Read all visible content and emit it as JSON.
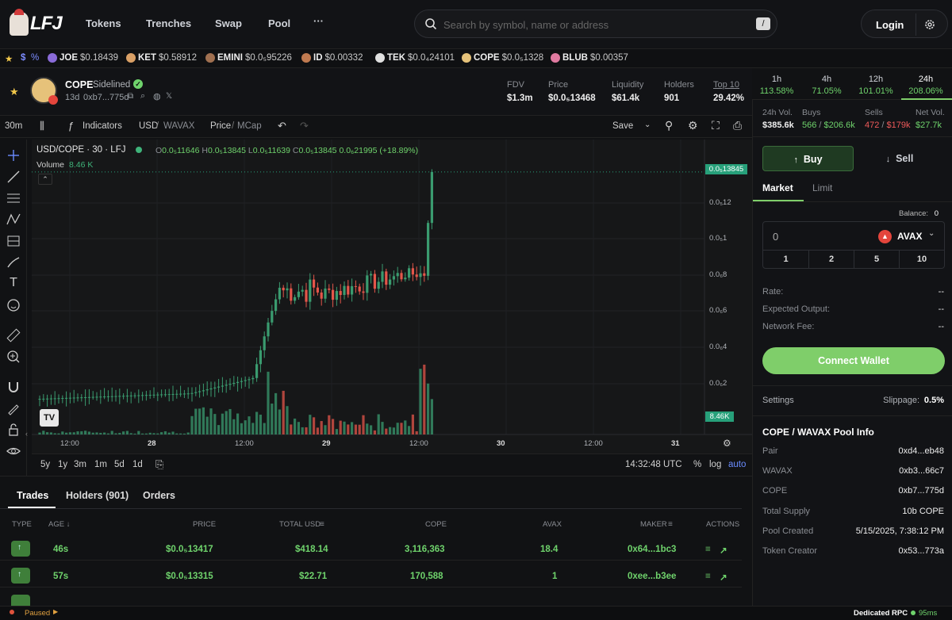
{
  "nav": {
    "logo": "LFJ",
    "tokens": "Tokens",
    "trenches": "Trenches",
    "swap": "Swap",
    "pool": "Pool",
    "more": "···"
  },
  "search": {
    "placeholder": "Search by symbol, name or address",
    "shortcut": "/"
  },
  "auth": {
    "login": "Login"
  },
  "ticker": {
    "percent": "%",
    "items": [
      {
        "sym": "JOE",
        "price": "$0.18439"
      },
      {
        "sym": "KET",
        "price": "$0.58912"
      },
      {
        "sym": "EMINI",
        "price": "$0.0₅95226"
      },
      {
        "sym": "ID",
        "price": "$0.00332"
      },
      {
        "sym": "TEK",
        "price": "$0.0₄24101"
      },
      {
        "sym": "COPE",
        "price": "$0.0₅1328"
      },
      {
        "sym": "BLUB",
        "price": "$0.00357"
      }
    ]
  },
  "token": {
    "name": "COPE",
    "status": "Sidelined",
    "age": "13d",
    "address": "0xb7...775d",
    "stats": [
      {
        "label": "FDV",
        "value": "$1.3m"
      },
      {
        "label": "Price",
        "value": "$0.0₅13468"
      },
      {
        "label": "Liquidity",
        "value": "$61.4k"
      },
      {
        "label": "Holders",
        "value": "901"
      },
      {
        "label": "Top 10",
        "value": "29.42%"
      }
    ]
  },
  "timeframes": [
    {
      "label": "1h",
      "change": "113.58%"
    },
    {
      "label": "4h",
      "change": "71.05%"
    },
    {
      "label": "12h",
      "change": "101.01%"
    },
    {
      "label": "24h",
      "change": "208.06%"
    }
  ],
  "volume": {
    "vol_label": "24h Vol.",
    "vol_value": "$385.6k",
    "buys_label": "Buys",
    "buys_count": "566",
    "buys_value": "$206.6k",
    "sells_label": "Sells",
    "sells_count": "472",
    "sells_value": "$179k",
    "net_label": "Net Vol.",
    "net_value": "$27.7k"
  },
  "charttb": {
    "interval": "30m",
    "indicators": "Indicators",
    "usd": "USD",
    "wavax": "WAVAX",
    "price": "Price",
    "mcap": "MCap",
    "save": "Save"
  },
  "chart": {
    "pair": "USD/COPE · 30 · LFJ",
    "o_label": "O",
    "o": "0.0₅11646",
    "h_label": "H",
    "h": "0.0₅13845",
    "l_label": "L",
    "l": "0.0₅11639",
    "c_label": "C",
    "c": "0.0₅13845",
    "change": "0.0₆21995 (+18.89%)",
    "volume_label": "Volume",
    "volume_value": "8.46 K",
    "last_price": "0.0₅13845",
    "last_volume": "8.46K",
    "y_ticks": [
      "0.0₅12",
      "0.0₅1",
      "0.0₆8",
      "0.0₆6",
      "0.0₆4",
      "0.0₆2"
    ],
    "x_ticks": [
      "12:00",
      "28",
      "12:00",
      "29",
      "12:00",
      "30",
      "12:00",
      "31"
    ]
  },
  "rangebar": {
    "ranges": [
      "5y",
      "1y",
      "3m",
      "1m",
      "5d",
      "1d"
    ],
    "time": "14:32:48 UTC",
    "pct": "%",
    "log": "log",
    "auto": "auto"
  },
  "trades": {
    "tabs": [
      "Trades",
      "Holders (901)",
      "Orders"
    ],
    "headers": {
      "type": "TYPE",
      "age": "AGE ↓",
      "price": "PRICE",
      "total": "TOTAL USD",
      "cope": "COPE",
      "avax": "AVAX",
      "maker": "MAKER",
      "actions": "ACTIONS"
    },
    "rows": [
      {
        "age": "46s",
        "price": "$0.0₅13417",
        "total": "$418.14",
        "cope": "3,116,363",
        "avax": "18.4",
        "maker": "0x64...1bc3"
      },
      {
        "age": "57s",
        "price": "$0.0₅13315",
        "total": "$22.71",
        "cope": "170,588",
        "avax": "1",
        "maker": "0xee...b3ee"
      }
    ]
  },
  "trade_panel": {
    "buy": "Buy",
    "sell": "Sell",
    "market": "Market",
    "limit": "Limit",
    "balance_label": "Balance:",
    "balance_value": "0",
    "amount": "0",
    "asset": "AVAX",
    "quick": [
      "1",
      "2",
      "5",
      "10"
    ],
    "rate_label": "Rate:",
    "rate_value": "--",
    "output_label": "Expected Output:",
    "output_value": "--",
    "fee_label": "Network Fee:",
    "fee_value": "--",
    "connect": "Connect Wallet",
    "settings": "Settings",
    "slippage_label": "Slippage:",
    "slippage_value": "0.5%"
  },
  "pool_info": {
    "title": "COPE / WAVAX Pool Info",
    "rows": [
      {
        "label": "Pair",
        "value": "0xd4...eb48"
      },
      {
        "label": "WAVAX",
        "value": "0xb3...66c7"
      },
      {
        "label": "COPE",
        "value": "0xb7...775d"
      },
      {
        "label": "Total Supply",
        "value": "10b COPE"
      },
      {
        "label": "Pool Created",
        "value": "5/15/2025, 7:38:12 PM"
      },
      {
        "label": "Token Creator",
        "value": "0x53...773a"
      }
    ]
  },
  "footer": {
    "paused": "Paused",
    "rpc": "Dedicated RPC",
    "latency": "95ms"
  },
  "colors": {
    "green": "#6fd36c",
    "red": "#ef5a5a",
    "up_candle": "#3a9b6f",
    "down_candle": "#e4564a",
    "accent": "#7fce6a"
  }
}
